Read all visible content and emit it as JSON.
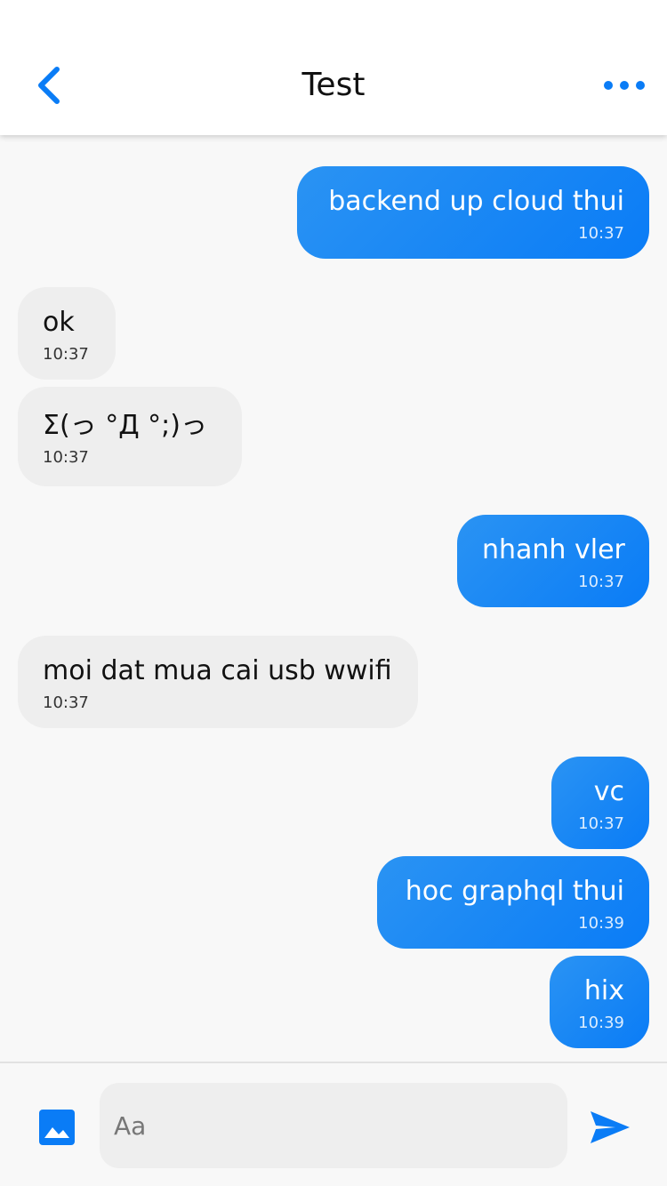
{
  "header": {
    "title": "Test",
    "back_icon": "chevron-left-icon",
    "more_icon": "more-horizontal-icon"
  },
  "colors": {
    "accent": "#0a7cf6",
    "incoming_bubble": "#eeeeee",
    "background": "#f8f8f8"
  },
  "messages": [
    {
      "from": "me",
      "text": "backend up cloud thui",
      "time": "10:37"
    },
    {
      "from": "them",
      "text": "ok",
      "time": "10:37"
    },
    {
      "from": "them",
      "text": "Σ(っ °Д °;)っ",
      "time": "10:37"
    },
    {
      "from": "me",
      "text": "nhanh vler",
      "time": "10:37"
    },
    {
      "from": "them",
      "text": "moi dat mua cai usb wwifi",
      "time": "10:37"
    },
    {
      "from": "me",
      "text": "vc",
      "time": "10:37"
    },
    {
      "from": "me",
      "text": "hoc graphql thui",
      "time": "10:39"
    },
    {
      "from": "me",
      "text": "hix",
      "time": "10:39"
    }
  ],
  "composer": {
    "placeholder": "Aa",
    "value": "",
    "image_icon": "image-icon",
    "send_icon": "send-icon"
  }
}
